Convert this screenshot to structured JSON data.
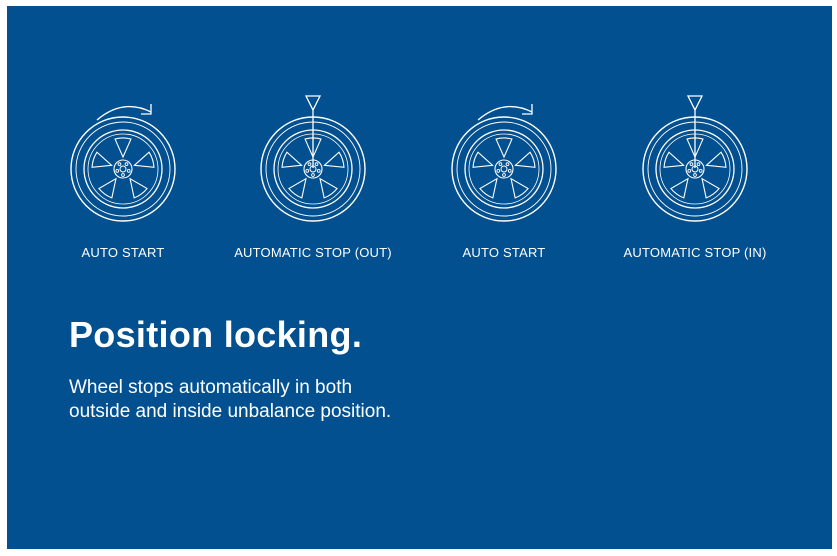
{
  "wheels": [
    {
      "caption": "AUTO START",
      "indicator": "rotate-arrow-icon"
    },
    {
      "caption": "AUTOMATIC STOP (OUT)",
      "indicator": "stop-pointer-icon"
    },
    {
      "caption": "AUTO START",
      "indicator": "rotate-arrow-icon"
    },
    {
      "caption": "AUTOMATIC STOP (IN)",
      "indicator": "stop-pointer-icon"
    }
  ],
  "headline": "Position locking.",
  "description": "Wheel stops automatically in both outside and inside unbalance position.",
  "colors": {
    "background": "#02508f",
    "foreground": "#ffffff",
    "page": "#ffffff"
  }
}
